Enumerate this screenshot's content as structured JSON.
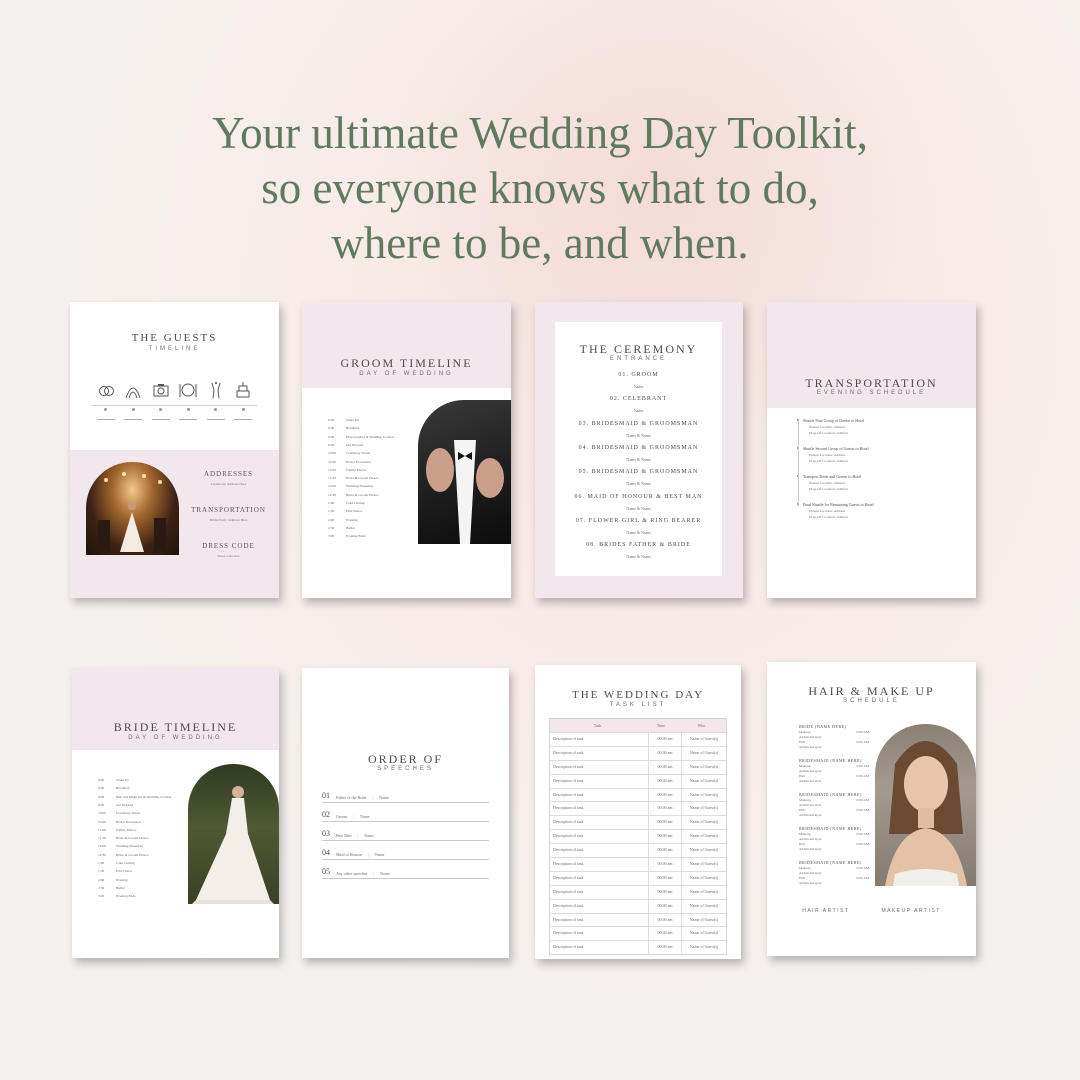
{
  "headline": {
    "line1": "Your ultimate Wedding Day Toolkit,",
    "line2": "so everyone knows what to do,",
    "line3": "where to be, and when."
  },
  "guests": {
    "title": "THE GUESTS",
    "subtitle": "TIMELINE",
    "icons": [
      "rings-icon",
      "arch-icon",
      "camera-icon",
      "dinner-icon",
      "champagne-icon",
      "cake-icon"
    ],
    "sections": [
      {
        "heading": "ADDRESSES",
        "text": "Ceremony: Address Here"
      },
      {
        "heading": "TRANSPORTATION",
        "text": "Bridal Party: Address Here"
      },
      {
        "heading": "DRESS CODE",
        "text": "Dress code here"
      }
    ]
  },
  "groom": {
    "title": "GROOM TIMELINE",
    "subtitle": "DAY OF WEDDING",
    "rows": [
      {
        "time": "8:00",
        "item": "Wake Up"
      },
      {
        "time": "8:30",
        "item": "Breakfast"
      },
      {
        "time": "9:00",
        "item": "Photographer & Wedding location"
      },
      {
        "time": "9:30",
        "item": "Get Dressed"
      },
      {
        "time": "10:00",
        "item": "Ceremony Venue"
      },
      {
        "time": "10:30",
        "item": "Bridal Procession"
      },
      {
        "time": "11:00",
        "item": "Family Photos"
      },
      {
        "time": "11:30",
        "item": "Bride & Groom Photos"
      },
      {
        "time": "12:00",
        "item": "Wedding Breakfast"
      },
      {
        "time": "12:30",
        "item": "Bride & Groom Photos"
      },
      {
        "time": "1:00",
        "item": "Cake Cutting"
      },
      {
        "time": "1:30",
        "item": "First Dance"
      },
      {
        "time": "2:00",
        "item": "Evening"
      },
      {
        "time": "2:30",
        "item": "Buffet"
      },
      {
        "time": "3:00",
        "item": "Evening Ends"
      }
    ]
  },
  "ceremony": {
    "title": "THE CEREMONY",
    "subtitle": "ENTRANCE",
    "items": [
      {
        "label": "01. GROOM",
        "names": "Name"
      },
      {
        "label": "02. CELEBRANT",
        "names": "Name"
      },
      {
        "label": "03. BRIDESMAID & GROOMSMAN",
        "names": "Name & Name"
      },
      {
        "label": "04. BRIDESMAID & GROOMSMAN",
        "names": "Name & Name"
      },
      {
        "label": "05. BRIDESMAID & GROOMSMAN",
        "names": "Name & Name"
      },
      {
        "label": "06. MAID OF HONOUR & BEST MAN",
        "names": "Name & Name"
      },
      {
        "label": "07. FLOWER GIRL & RING BEARER",
        "names": "Name & Name"
      },
      {
        "label": "08. BRIDES FATHER & BRIDE",
        "names": "Name & Name"
      }
    ]
  },
  "transport": {
    "title": "TRANSPORTATION",
    "subtitle": "EVENING SCHEDULE",
    "items": [
      {
        "head": "Shuttle First Group of Guests to Hotel",
        "l1": "Pickup Location: Address",
        "l2": "Drop-off Location: Address"
      },
      {
        "head": "Shuttle Second Group of Guests to Hotel",
        "l1": "Pickup Location: Address",
        "l2": "Drop-off Location: Address"
      },
      {
        "head": "Transport Bride and Groom to Hotel",
        "l1": "Pickup Location: Address",
        "l2": "Drop-off Location: Address"
      },
      {
        "head": "Final Shuttle for Remaining Guests to Hotel",
        "l1": "Pickup Location: Address",
        "l2": "Drop-off Location: Address"
      }
    ]
  },
  "bride": {
    "title": "BRIDE TIMELINE",
    "subtitle": "DAY OF WEDDING",
    "rows": [
      {
        "time": "8:00",
        "item": "Wake Up"
      },
      {
        "time": "8:30",
        "item": "Breakfast"
      },
      {
        "time": "9:00",
        "item": "Hair and Make Up & Wedding location"
      },
      {
        "time": "9:30",
        "item": "Get Dressed"
      },
      {
        "time": "10:00",
        "item": "Ceremony Venue"
      },
      {
        "time": "10:30",
        "item": "Bridal Procession"
      },
      {
        "time": "11:00",
        "item": "Family Photos"
      },
      {
        "time": "11:30",
        "item": "Bride & Groom Photos"
      },
      {
        "time": "12:00",
        "item": "Wedding Breakfast"
      },
      {
        "time": "12:30",
        "item": "Bride & Groom Photos"
      },
      {
        "time": "1:00",
        "item": "Cake Cutting"
      },
      {
        "time": "1:30",
        "item": "First Dance"
      },
      {
        "time": "2:00",
        "item": "Evening"
      },
      {
        "time": "2:30",
        "item": "Buffet"
      },
      {
        "time": "3:00",
        "item": "Evening Ends"
      }
    ]
  },
  "speeches": {
    "title": "ORDER OF",
    "subtitle": "SPEECHES",
    "items": [
      {
        "num": "01",
        "role": "Father of the Bride",
        "name": "Name"
      },
      {
        "num": "02",
        "role": "Groom",
        "name": "Name"
      },
      {
        "num": "03",
        "role": "Best Man",
        "name": "Name"
      },
      {
        "num": "04",
        "role": "Maid of Honour",
        "name": "Name"
      },
      {
        "num": "05",
        "role": "Any other speeches",
        "name": "Name"
      }
    ]
  },
  "tasks": {
    "title": "THE WEDDING DAY",
    "subtitle": "TASK LIST",
    "headers": [
      "Task",
      "Time",
      "Who"
    ],
    "row_task": "Description of task",
    "row_time": "00:00 am",
    "row_who": "Name of Guest(s)",
    "row_count": 16
  },
  "hair": {
    "title": "HAIR & MAKE UP",
    "subtitle": "SCHEDULE",
    "people": [
      {
        "name": "BRIDE (NAME HERE)"
      },
      {
        "name": "BRIDESMAID (NAME HERE)"
      },
      {
        "name": "BRIDESMAID (NAME HERE)"
      },
      {
        "name": "BRIDESMAID (NAME HERE)"
      },
      {
        "name": "BRIDESMAID (NAME HERE)"
      }
    ],
    "lines": [
      "Makeup",
      "Additional style",
      "Hair",
      "Additional style"
    ],
    "times": [
      "0:00 AM",
      "0:00 AM"
    ],
    "artists": [
      "HAIR ARTIST",
      "MAKEUP ARTIST"
    ]
  },
  "colors": {
    "headline": "#5f7a5c",
    "pink": "#f3e7ee",
    "text": "#4e4a48"
  }
}
